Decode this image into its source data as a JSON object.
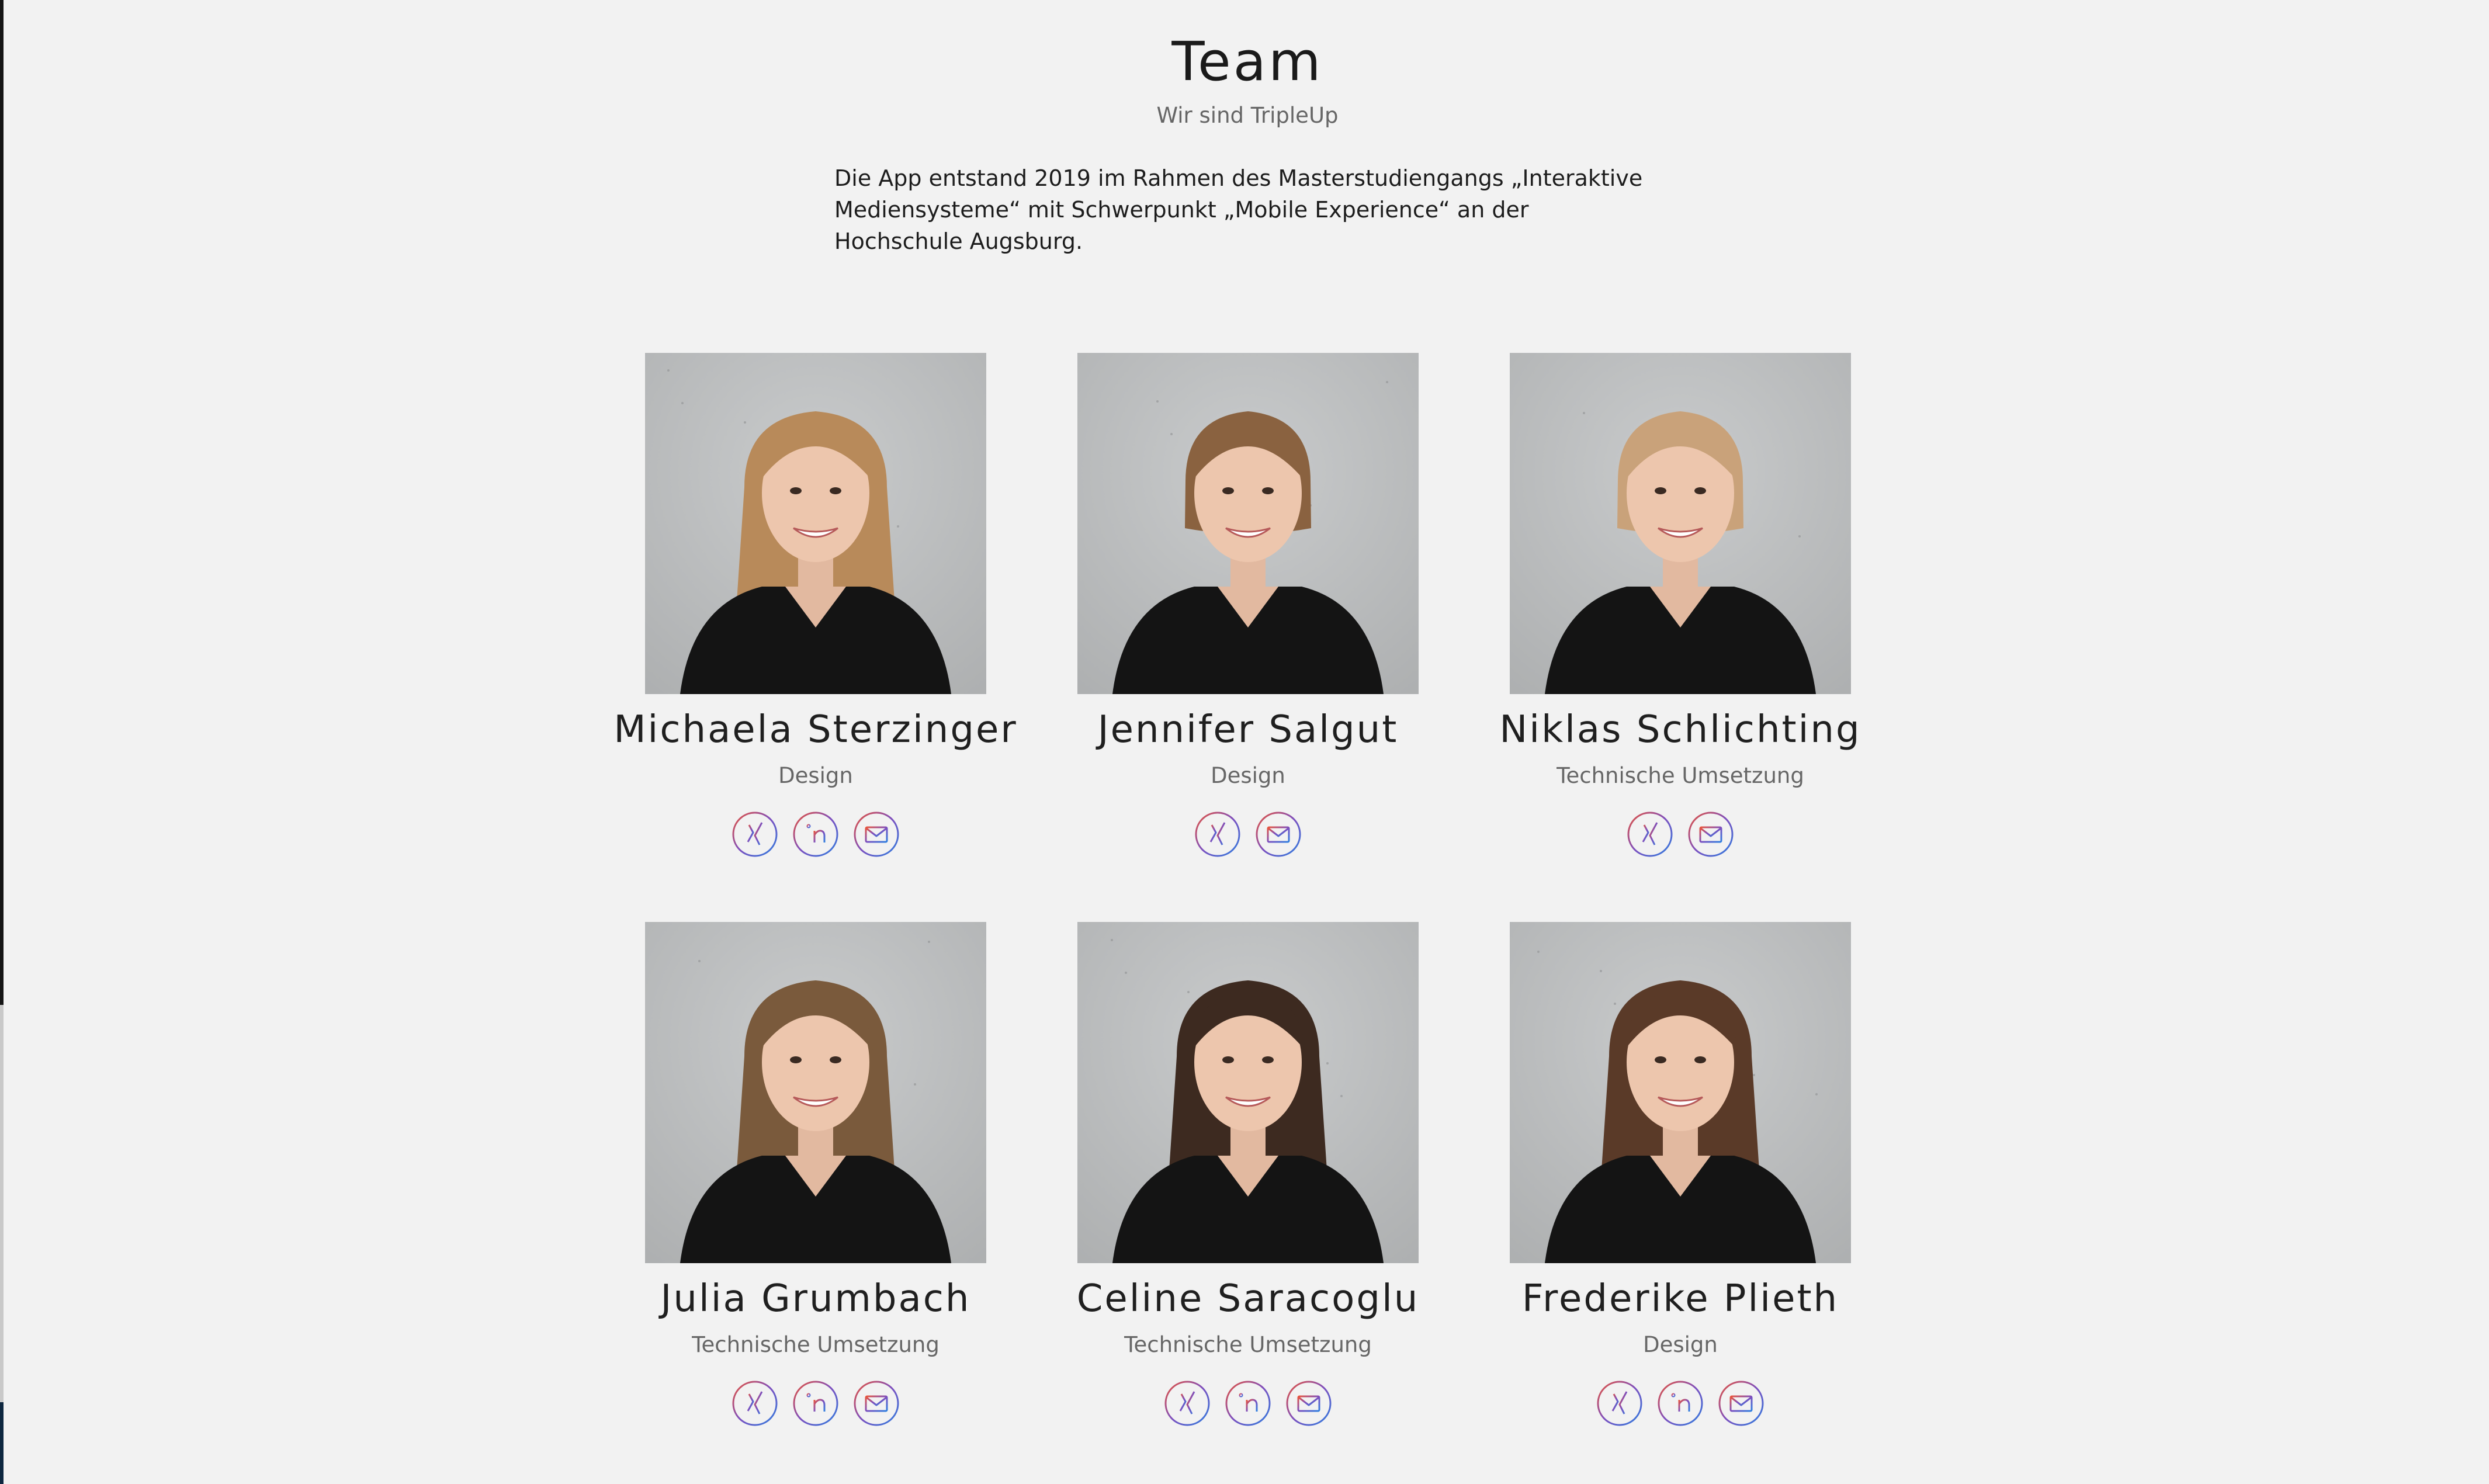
{
  "header": {
    "title": "Team",
    "subtitle": "Wir sind TripleUp"
  },
  "intro": {
    "text": "Die App entstand 2019 im Rahmen des Masterstudiengangs „Interaktive Mediensysteme“ mit Schwerpunkt „Mobile Experience“ an der Hochschule Augsburg."
  },
  "colors": {
    "background": "#f2f2f2",
    "ring_gradient_start": "#e8553d",
    "ring_gradient_mid": "#7d4fbf",
    "ring_gradient_end": "#2f7fe0",
    "muted_text": "#666666"
  },
  "members": [
    {
      "name": "Michaela Sterzinger",
      "role": "Design",
      "links": [
        "xing-icon",
        "linkedin-icon",
        "mail-icon"
      ]
    },
    {
      "name": "Jennifer Salgut",
      "role": "Design",
      "links": [
        "xing-icon",
        "mail-icon"
      ]
    },
    {
      "name": "Niklas Schlichting",
      "role": "Technische Umsetzung",
      "links": [
        "xing-icon",
        "mail-icon"
      ]
    },
    {
      "name": "Julia Grumbach",
      "role": "Technische Umsetzung",
      "links": [
        "xing-icon",
        "linkedin-icon",
        "mail-icon"
      ]
    },
    {
      "name": "Celine Saracoglu",
      "role": "Technische Umsetzung",
      "links": [
        "xing-icon",
        "linkedin-icon",
        "mail-icon"
      ]
    },
    {
      "name": "Frederike Plieth",
      "role": "Design",
      "links": [
        "xing-icon",
        "linkedin-icon",
        "mail-icon"
      ]
    }
  ]
}
